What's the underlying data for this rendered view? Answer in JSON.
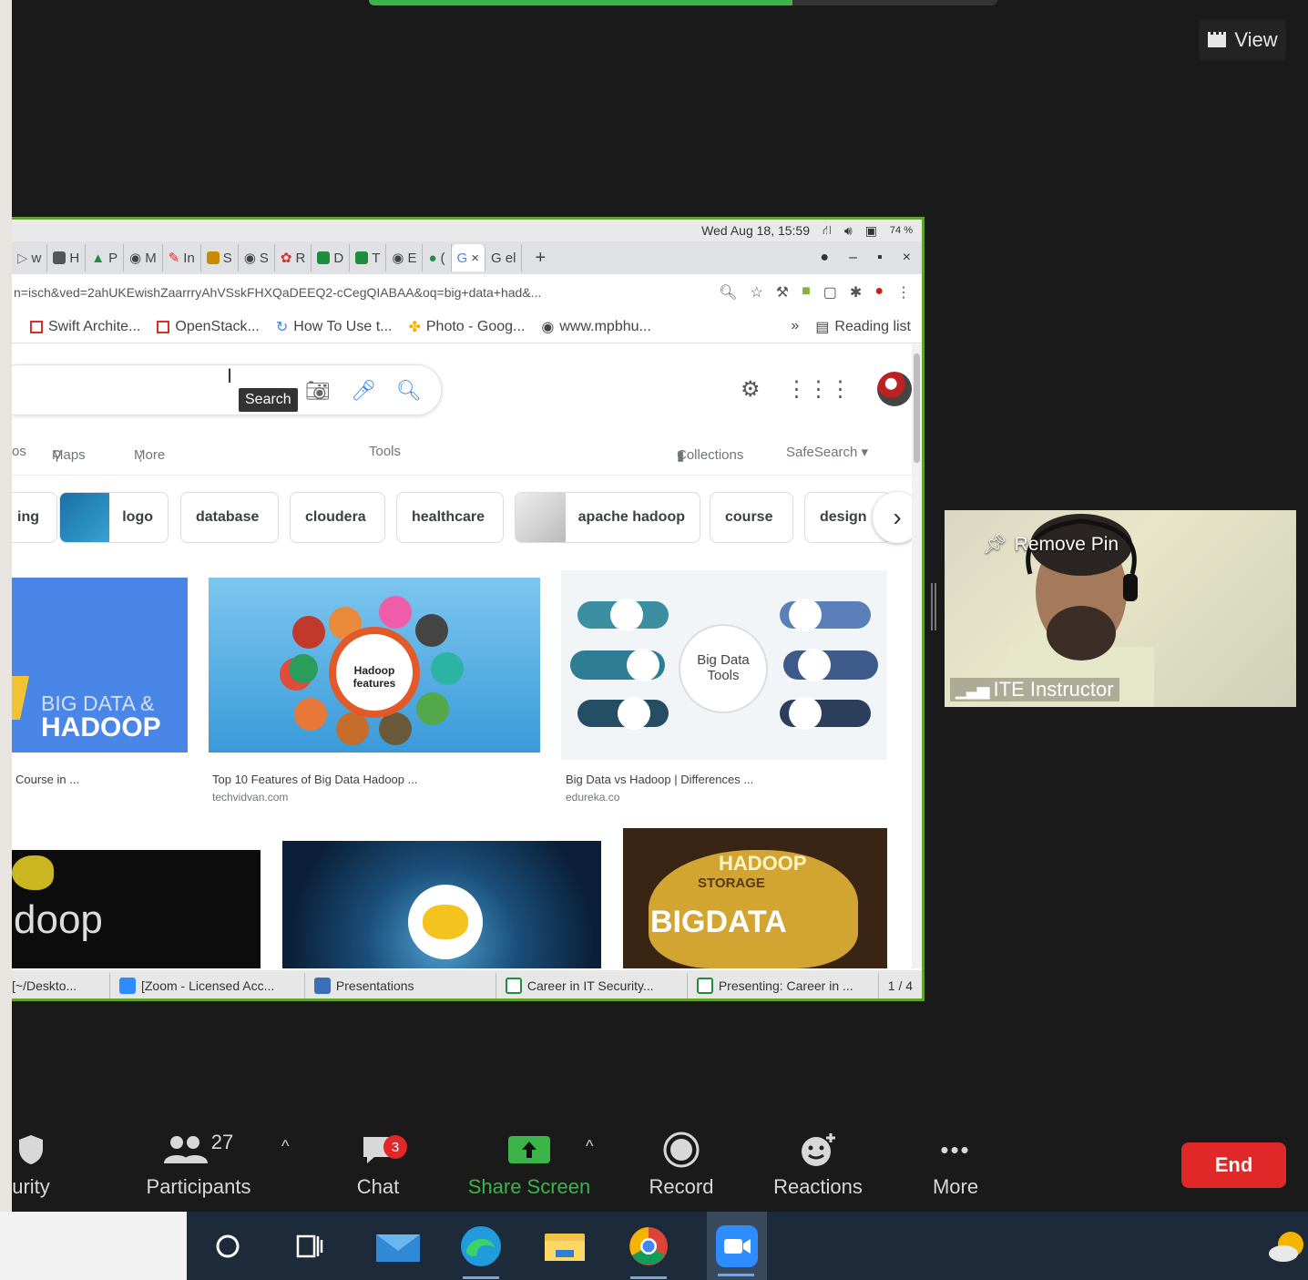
{
  "zoom": {
    "view_label": "View"
  },
  "shared_screen": {
    "os_status": {
      "datetime": "Wed Aug 18, 15:59",
      "battery": "74 %"
    },
    "tabs": [
      {
        "label": "w",
        "color": "#777777"
      },
      {
        "label": "H",
        "color": "#555555"
      },
      {
        "label": "P",
        "color": "#1e8e3e"
      },
      {
        "label": "M",
        "color": "#444444"
      },
      {
        "label": "In",
        "color": "#d93025"
      },
      {
        "label": "S",
        "color": "#c98b00"
      },
      {
        "label": "S",
        "color": "#444444"
      },
      {
        "label": "R",
        "color": "#d93025"
      },
      {
        "label": "D",
        "color": "#1e8e3e"
      },
      {
        "label": "T",
        "color": "#1e8e3e"
      },
      {
        "label": "E",
        "color": "#444444"
      },
      {
        "label": "(",
        "color": "#1e8e3e"
      },
      {
        "label": "G",
        "color": "#4285f4",
        "close": "×"
      },
      {
        "label": "G el",
        "color": "#4285f4"
      }
    ],
    "new_tab": "+",
    "window_controls": [
      "●",
      "–",
      "▪",
      "×"
    ],
    "url": "n=isch&ved=2ahUKEwishZaarrryAhVSskFHXQaDEEQ2-cCegQIABAA&oq=big+data+had&...",
    "bookmarks": [
      "Swift Archite...",
      "OpenStack...",
      "How To Use t...",
      "Photo - Goog...",
      "www.mpbhu..."
    ],
    "bookmarks_more": "»",
    "reading_list": "Reading list",
    "google": {
      "tooltip": "Search",
      "nav": {
        "partial": "os",
        "maps": "Maps",
        "more": "More",
        "tools": "Tools",
        "collections": "Collections",
        "safesearch": "SafeSearch ▾"
      },
      "chips": [
        "ing",
        "logo",
        "database",
        "cloudera",
        "healthcare",
        "apache hadoop",
        "course",
        "design"
      ],
      "results": [
        {
          "caption": "Course in ...",
          "source": "",
          "big": "BIG DATA &",
          "big2": "HADOOP"
        },
        {
          "caption": "Top 10 Features of Big Data Hadoop ...",
          "source": "techvidvan.com",
          "center": "Hadoop features"
        },
        {
          "caption": "Big Data vs Hadoop | Differences ...",
          "source": "edureka.co",
          "center": "Big Data Tools"
        }
      ],
      "row2": {
        "doop": "doop",
        "hadoop": "HADOOP",
        "storage": "STORAGE",
        "bigdata": "BIGDATA"
      }
    },
    "taskbar": [
      {
        "label": "[~/Deskto...",
        "color": "#888888"
      },
      {
        "label": "[Zoom - Licensed Acc...",
        "color": "#2d8cff"
      },
      {
        "label": "Presentations",
        "color": "#3b6fb6"
      },
      {
        "label": "Career in IT Security...",
        "color": "#1e8e3e"
      },
      {
        "label": "Presenting: Career in ...",
        "color": "#1e8e3e"
      }
    ],
    "page_indicator": "1 / 4"
  },
  "video": {
    "pin_label": "Remove Pin",
    "participant_name": "ITE Instructor"
  },
  "toolbar": {
    "security": "urity",
    "participants": "Participants",
    "participants_count": "27",
    "chat": "Chat",
    "chat_badge": "3",
    "share": "Share Screen",
    "record": "Record",
    "reactions": "Reactions",
    "more": "More",
    "end": "End"
  },
  "colors": {
    "zoom_bg": "#1a1a1a",
    "share_green": "#3bb54a",
    "end_red": "#e02828"
  }
}
